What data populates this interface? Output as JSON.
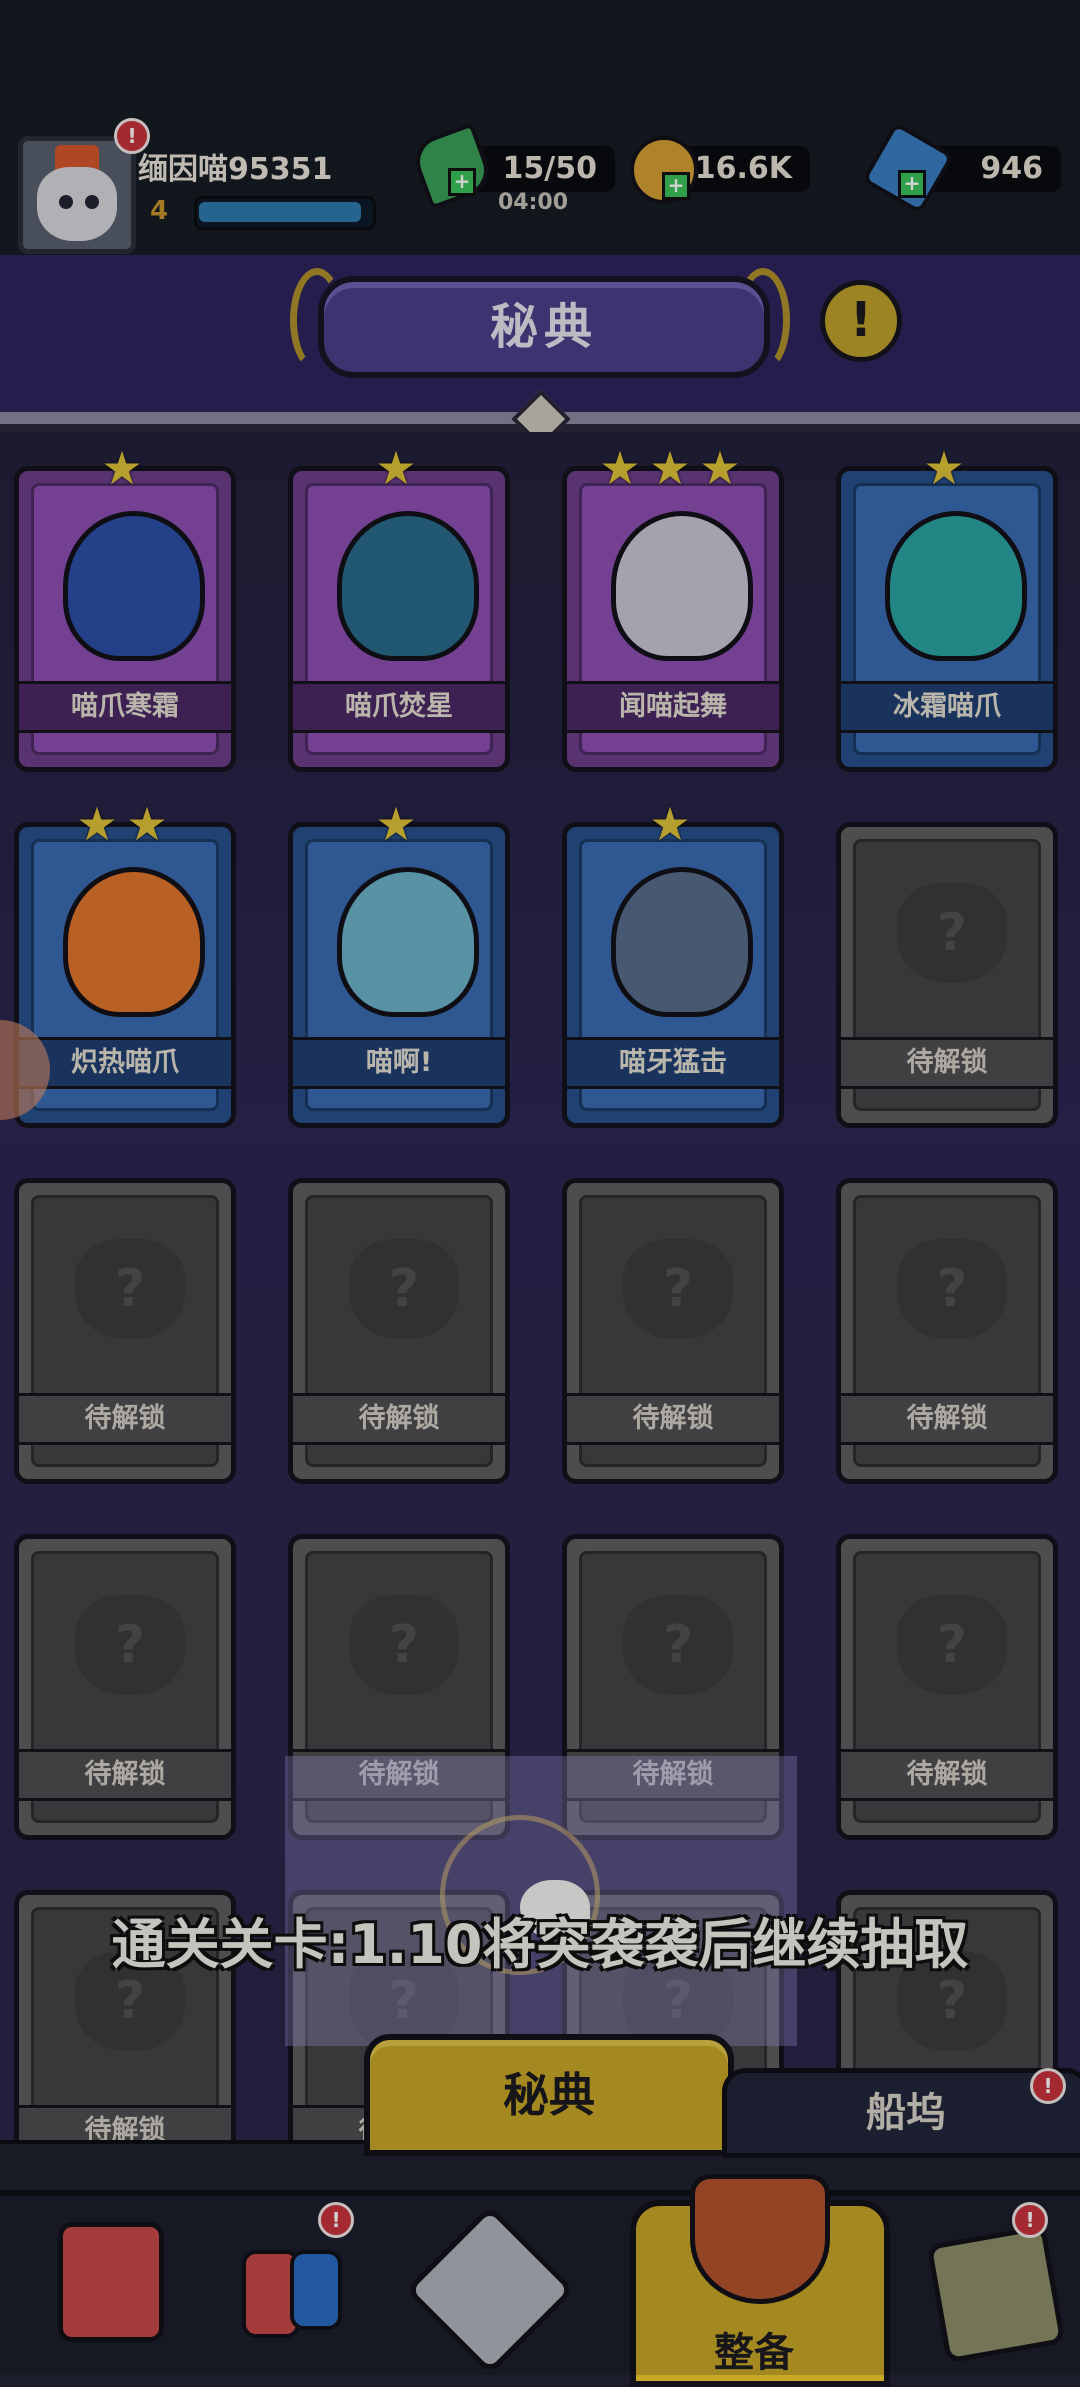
{
  "player": {
    "name": "缅因喵95351",
    "level": "4",
    "xp_fraction": 0.95
  },
  "resources": {
    "energy": "15/50",
    "energy_timer": "04:00",
    "coins": "16.6K",
    "gems": "946"
  },
  "header": {
    "title": "秘典"
  },
  "cards": [
    {
      "label": "喵爪寒霜",
      "stars": 1,
      "style": "purple",
      "color": "#2b4fa6"
    },
    {
      "label": "喵爪焚星",
      "stars": 1,
      "style": "purple",
      "color": "#2a6b8a"
    },
    {
      "label": "闻喵起舞",
      "stars": 3,
      "style": "purple",
      "color": "#c9c6d2"
    },
    {
      "label": "冰霜喵爪",
      "stars": 1,
      "style": "blue",
      "color": "#2aa5a2"
    },
    {
      "label": "炽热喵爪",
      "stars": 2,
      "style": "blue",
      "color": "#e2762c"
    },
    {
      "label": "喵啊!",
      "stars": 1,
      "style": "blue",
      "color": "#6cb2c9"
    },
    {
      "label": "喵牙猛击",
      "stars": 1,
      "style": "blue",
      "color": "#5a6c8a"
    },
    {
      "label": "待解锁",
      "stars": 0,
      "style": "lock"
    },
    {
      "label": "待解锁",
      "stars": 0,
      "style": "lock"
    },
    {
      "label": "待解锁",
      "stars": 0,
      "style": "lock"
    },
    {
      "label": "待解锁",
      "stars": 0,
      "style": "lock"
    },
    {
      "label": "待解锁",
      "stars": 0,
      "style": "lock"
    },
    {
      "label": "待解锁",
      "stars": 0,
      "style": "lock"
    },
    {
      "label": "待解锁",
      "stars": 0,
      "style": "lock"
    },
    {
      "label": "待解锁",
      "stars": 0,
      "style": "lock"
    },
    {
      "label": "待解锁",
      "stars": 0,
      "style": "lock"
    },
    {
      "label": "待解锁",
      "stars": 0,
      "style": "lock"
    },
    {
      "label": "待解锁",
      "stars": 0,
      "style": "lock"
    },
    {
      "label": "待解锁",
      "stars": 0,
      "style": "lock"
    },
    {
      "label": "待解锁",
      "stars": 0,
      "style": "lock"
    }
  ],
  "hint": "通关关卡:1.10将突袭袭后继续抽取",
  "tabs": {
    "codex": "秘典",
    "dock": "船坞"
  },
  "nav": {
    "active_label": "整备",
    "icons": [
      "shop-house-icon",
      "team-cats-icon",
      "battle-swords-icon",
      "ship-icon",
      "map-scroll-icon"
    ]
  },
  "colors": {
    "accent": "#c9a828",
    "header": "#2e255f",
    "alert": "#c8323c"
  }
}
